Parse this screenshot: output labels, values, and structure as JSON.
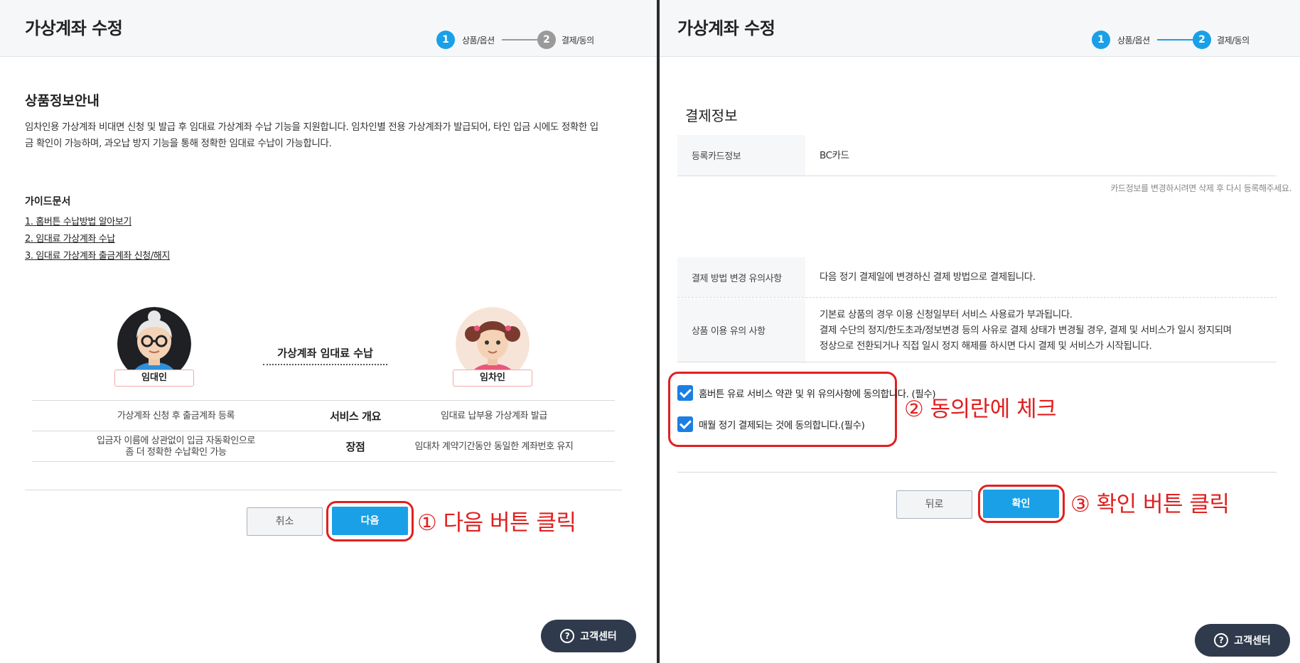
{
  "left": {
    "header": {
      "title": "가상계좌 수정",
      "steps": [
        {
          "num": "1",
          "label": "상품/옵션",
          "active": true
        },
        {
          "num": "2",
          "label": "결제/동의",
          "active": false
        }
      ]
    },
    "product_info": {
      "heading": "상품정보안내",
      "desc_line1": "임차인용 가상계좌 비대면 신청 및 발급 후 임대료 가상계좌 수납 기능을 지원합니다. 임차인별 전용 가상계좌가 발급되어, 타인 입금 시에도 정확한 입",
      "desc_line2": "금 확인이 가능하며, 과오납 방지 기능을 통해 정확한 임대료 수납이 가능합니다."
    },
    "guide": {
      "title": "가이드문서",
      "links": [
        "1. 홈버튼 수납방법 알아보기",
        "2. 임대료 가상계좌 수납",
        "3. 임대료 가상계좌 출금계좌 신청/해지"
      ]
    },
    "illustration": {
      "landlord_label": "임대인",
      "tenant_label": "임차인",
      "caption": "가상계좌 임대료 수납"
    },
    "table": {
      "rows": [
        {
          "left": "가상계좌 신청 후 출금계좌 등록",
          "center": "서비스 개요",
          "right": "임대료 납부용 가상계좌 발급"
        },
        {
          "left_line1": "입금자 이름에 상관없이 입금 자동확인으로",
          "left_line2": "좀 더 정확한 수납확인 가능",
          "center": "장점",
          "right": "임대차 계약기간동안 동일한 계좌번호 유지"
        }
      ]
    },
    "buttons": {
      "cancel": "취소",
      "next": "다음"
    },
    "annotation": "① 다음 버튼 클릭",
    "help": "고객센터"
  },
  "right": {
    "header": {
      "title": "가상계좌 수정",
      "steps": [
        {
          "num": "1",
          "label": "상품/옵션",
          "active": true
        },
        {
          "num": "2",
          "label": "결제/동의",
          "active": true
        }
      ]
    },
    "payment": {
      "heading": "결제정보",
      "card_key": "등록카드정보",
      "card_value": "BC카드",
      "card_note": "카드정보를 변경하시려면 삭제 후 다시 등록해주세요.",
      "change_key": "결제 방법 변경 유의사항",
      "change_value": "다음 정기 결제일에 변경하신 결제 방법으로 결제됩니다.",
      "usage_key": "상품 이용 유의 사항",
      "usage_line1": "기본료 상품의 경우 이용 신청일부터 서비스 사용료가 부과됩니다.",
      "usage_line2": "결제 수단의 정지/한도초과/정보변경 등의 사유로 결제 상태가 변경될 경우, 결제 및 서비스가 일시 정지되며",
      "usage_line3": "정상으로 전환되거나 직접 일시 정지 해제를 하시면 다시 결제 및 서비스가 시작됩니다."
    },
    "agreements": [
      {
        "text": "홈버튼 유료 서비스 약관 및 위 유의사항에 동의합니다. (필수)",
        "checked": true
      },
      {
        "text": "매월 정기 결제되는 것에 동의합니다.(필수)",
        "checked": true
      }
    ],
    "annotation_check": "② 동의란에 체크",
    "buttons": {
      "back": "뒤로",
      "confirm": "확인"
    },
    "annotation_confirm": "③ 확인 버튼 클릭",
    "help": "고객센터"
  },
  "colors": {
    "accent": "#1aa0e6",
    "annotation": "#e02020",
    "step_inactive": "#9a9a9a"
  }
}
